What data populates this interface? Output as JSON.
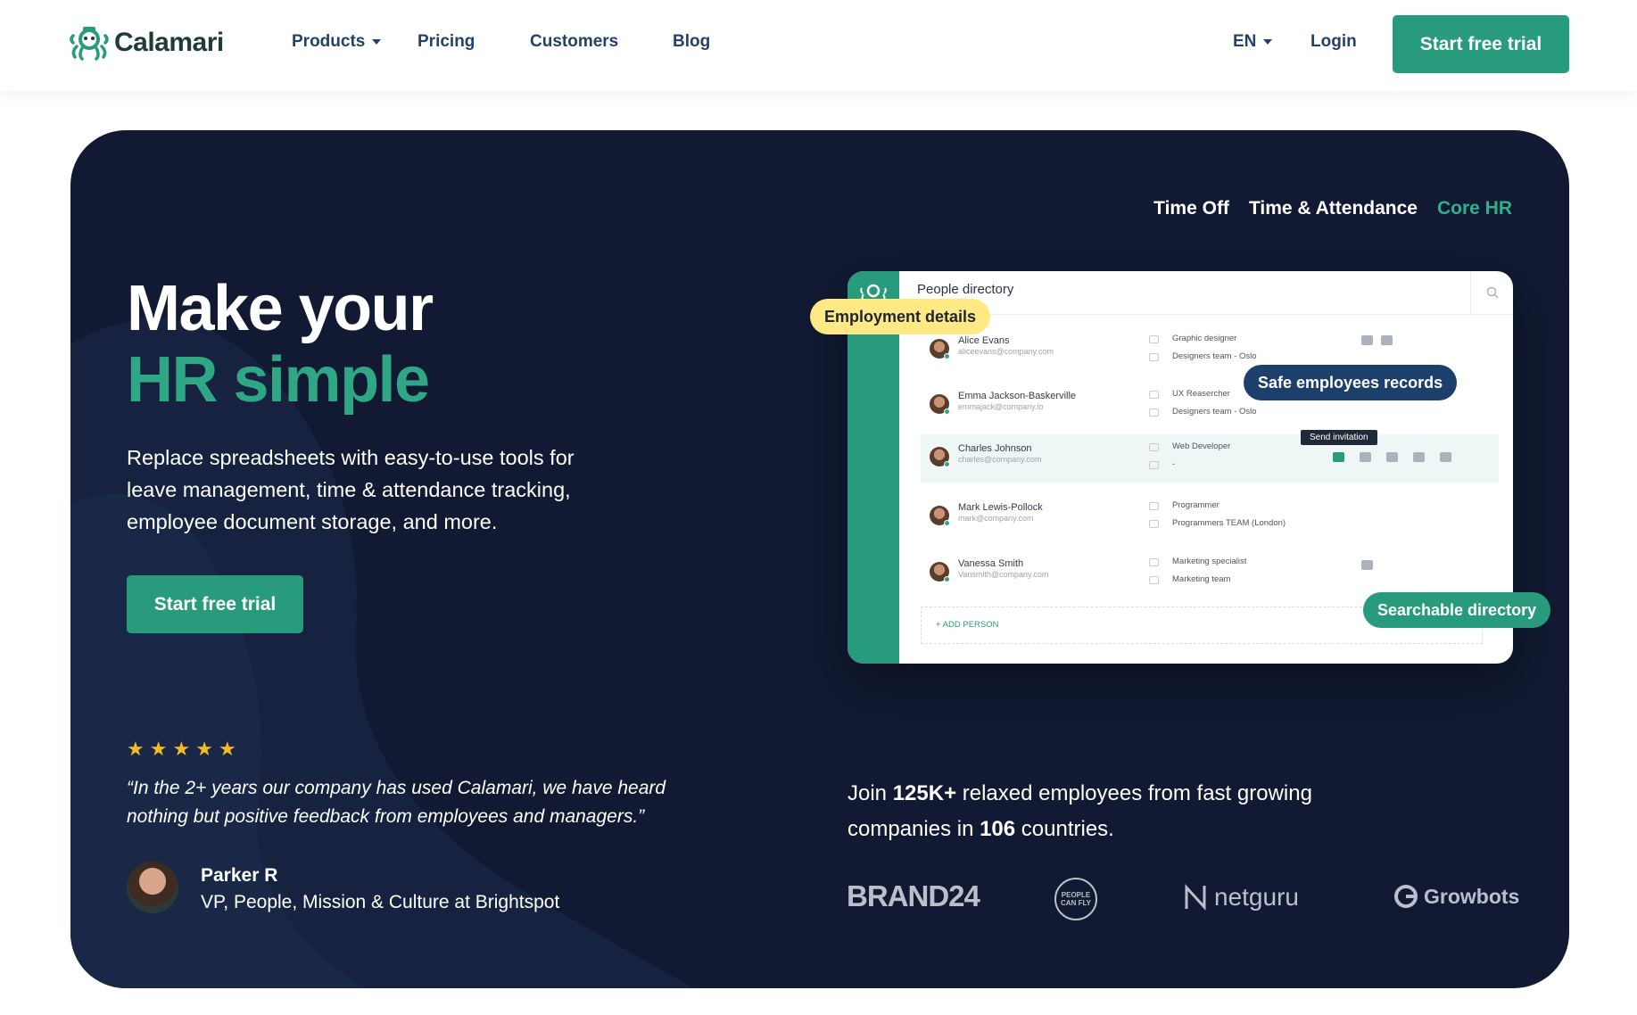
{
  "brand": {
    "name": "Calamari"
  },
  "nav": {
    "products": "Products",
    "pricing": "Pricing",
    "customers": "Customers",
    "blog": "Blog",
    "language": "EN",
    "login": "Login",
    "cta": "Start free trial"
  },
  "hero": {
    "tabs": [
      "Time Off",
      "Time & Attendance",
      "Core HR"
    ],
    "active_tab": "Core HR",
    "title_line1": "Make your",
    "title_line2": "HR simple",
    "subtitle": "Replace spreadsheets with easy-to-use tools for leave management, time & attendance tracking, employee document storage, and more.",
    "cta": "Start free trial"
  },
  "mockup": {
    "title": "People directory",
    "people": [
      {
        "name": "Alice Evans",
        "email": "aliceevans@company.com",
        "role": "Graphic designer",
        "team": "Designers team - Oslo"
      },
      {
        "name": "Emma Jackson-Baskerville",
        "email": "emmajack@company.io",
        "role": "UX Reasercher",
        "team": "Designers team - Oslo"
      },
      {
        "name": "Charles Johnson",
        "email": "charles@company.com",
        "role": "Web Developer",
        "team": "-"
      },
      {
        "name": "Mark Lewis-Pollock",
        "email": "mark@company.com",
        "role": "Programmer",
        "team": "Programmers TEAM (London)"
      },
      {
        "name": "Vanessa Smith",
        "email": "Vansmith@company.com",
        "role": "Marketing specialist",
        "team": "Marketing team"
      }
    ],
    "add_person": "+ ADD PERSON",
    "tooltip": "Send invitation",
    "badges": {
      "employment": "Employment details",
      "safe": "Safe employees records",
      "searchable": "Searchable directory"
    }
  },
  "testimonial": {
    "stars": 5,
    "quote": "“In the 2+ years our company has used Calamari, we have heard nothing but positive feedback from employees and managers.”",
    "author": "Parker R",
    "role": "VP, People, Mission & Culture at Brightspot"
  },
  "social_proof": {
    "join_prefix": "Join ",
    "employees": "125K+",
    "join_mid": " relaxed employees from fast growing companies in ",
    "countries": "106",
    "join_suffix": " countries."
  },
  "logos": {
    "brand24": "BRAND24",
    "peoplecanfly": "PEOPLE CAN FLY",
    "netguru": "netguru",
    "growbots": "Growbots"
  },
  "colors": {
    "accent": "#279b7c",
    "hero_bg": "#111a32",
    "nav_text": "#24416b",
    "star": "#f6bb23",
    "badge_yellow": "#ffe984",
    "badge_navy": "#1d3f6c"
  }
}
